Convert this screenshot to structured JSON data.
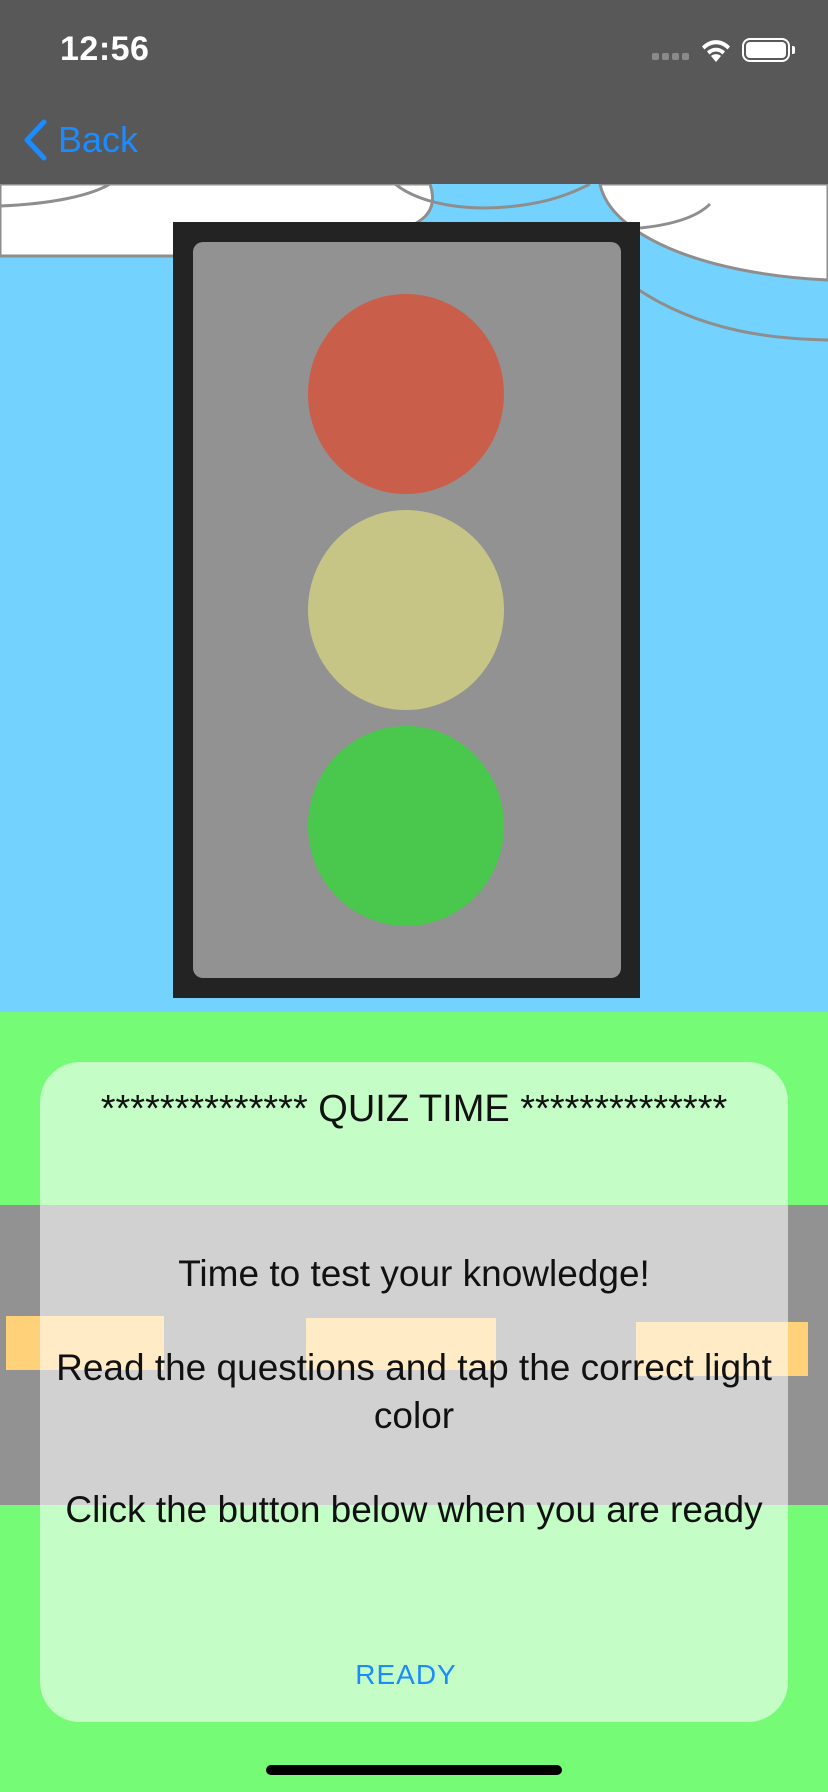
{
  "status_bar": {
    "time": "12:56"
  },
  "nav": {
    "back_label": "Back"
  },
  "traffic_light": {
    "colors": {
      "frame": "#232323",
      "housing": "#929292",
      "red": "#c95f4a",
      "yellow": "#c6c586",
      "green": "#4ac74d"
    }
  },
  "scene": {
    "colors": {
      "sky": "#74d3fe",
      "grass": "#76fb77",
      "road": "#929292",
      "stripe": "#ffd27a"
    }
  },
  "quiz_card": {
    "title": "************** QUIZ TIME **************",
    "paragraph_1": "Time to test your knowledge!",
    "paragraph_2": "Read the questions and tap the correct light color",
    "paragraph_3": "Click the button below when you are ready",
    "ready_button": "READY"
  },
  "accent_color": "#1a8cff"
}
